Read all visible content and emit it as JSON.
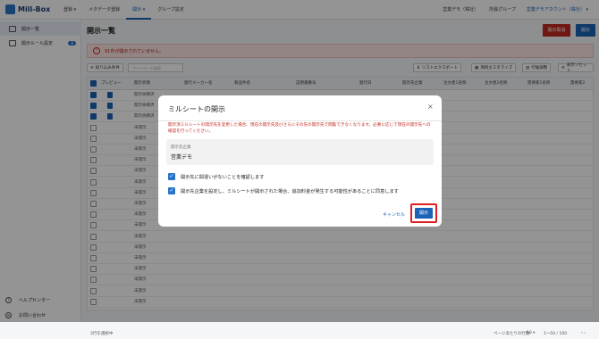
{
  "app": {
    "name": "Mill-Box"
  },
  "nav": [
    {
      "label": "登録 ▾",
      "active": false
    },
    {
      "label": "メタデータ登録",
      "active": false
    },
    {
      "label": "開示 ▾",
      "active": true
    },
    {
      "label": "グループ設定",
      "active": false
    }
  ],
  "topright": {
    "org": "営業デモ（株社）",
    "group": "所属グループ",
    "account": "営業デモアカウント（株社） ▾"
  },
  "sidebar": {
    "items": [
      {
        "label": "開示一覧",
        "selected": true
      },
      {
        "label": "開示ルール設定",
        "badge": "0"
      }
    ],
    "help": "ヘルプセンター",
    "contact": "お問い合わせ"
  },
  "page": {
    "title": "開示一覧",
    "btn_unpublish": "開示取消",
    "btn_publish": "開示"
  },
  "alert": {
    "text": "91件が開示されていません。"
  },
  "toolbar": {
    "filter": "絞り込み条件",
    "search_placeholder": "フリーワード検索",
    "export": "リストエクスポート",
    "customize": "項目カスタマイズ",
    "width": "行幅調整",
    "reset": "表示リセット"
  },
  "table": {
    "headers": [
      "プレビュー",
      "開示状態",
      "発行メーカー名",
      "製品件名",
      "証明書番号",
      "発行日",
      "開示先企業",
      "注文者1名称",
      "注文者2名称",
      "需要家1名称",
      "需要家2"
    ],
    "rows": [
      {
        "checked": true,
        "status": "開示依頼済"
      },
      {
        "checked": true,
        "status": "開示依頼済"
      },
      {
        "checked": true,
        "status": "開示依頼済"
      },
      {
        "checked": false,
        "status": "未開示"
      },
      {
        "checked": false,
        "status": "未開示"
      },
      {
        "checked": false,
        "status": "未開示"
      },
      {
        "checked": false,
        "status": "未開示"
      },
      {
        "checked": false,
        "status": "未開示"
      },
      {
        "checked": false,
        "status": "未開示"
      },
      {
        "checked": false,
        "status": "未開示"
      },
      {
        "checked": false,
        "status": "未開示"
      },
      {
        "checked": false,
        "status": "未開示"
      },
      {
        "checked": false,
        "status": "未開示"
      },
      {
        "checked": false,
        "status": "未開示"
      },
      {
        "checked": false,
        "status": "未開示"
      },
      {
        "checked": false,
        "status": "未開示"
      },
      {
        "checked": false,
        "status": "未開示"
      },
      {
        "checked": false,
        "status": "未開示"
      },
      {
        "checked": false,
        "status": "未開示"
      },
      {
        "checked": false,
        "status": "未開示"
      }
    ]
  },
  "footer": {
    "selected": "3行を選択中",
    "per_page_label": "ページあたりの行数:",
    "per_page": "50 ▾",
    "range": "1〜50 / 100",
    "nav": "‹ ›"
  },
  "modal": {
    "title": "ミルシートの開示",
    "close": "×",
    "warning": "開示済ミルシートの開示先を変更した場合、現在の開示先及びさらにその先の開示先で閲覧できなくなります。必要に応じて現在の開示先への確認を行ってください。",
    "company_label": "開示先企業",
    "company_value": "営業デモ",
    "check1": "開示先に間違いがないことを確認します",
    "check2": "開示先企業を設定し、ミルシートが開示された場合、追加料金が発生する可能性があることに同意します",
    "cancel": "キャンセル",
    "confirm": "開示"
  },
  "colors": {
    "accent": "#1b63b5",
    "danger": "#c0281f",
    "highlight": "#e02020"
  }
}
